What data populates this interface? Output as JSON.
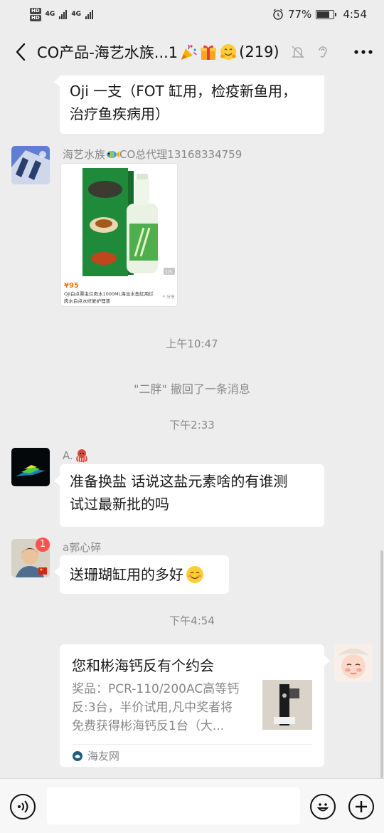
{
  "status_bar": {
    "left_hd_top": "HD",
    "left_hd_bottom": "HD",
    "net1": "4G",
    "net2": "4G",
    "battery": "77%",
    "time": "4:54"
  },
  "header": {
    "title": "CO产品-海艺水族...1",
    "count": "(219)"
  },
  "messages": {
    "top_bubble_line1": "Oji 一支（FOT 缸用，检疫新鱼用，",
    "top_bubble_line2": "治疗鱼疾病用）",
    "shop_sender": "海艺水族",
    "shop_sender_suffix": "CO总代理13168334759",
    "product_price": "¥95",
    "product_desc_line1": "OJI白点票虫烂肉水1000ML海淡水鱼缸用烂",
    "product_desc_line2": "肉水白点水修复护理液",
    "product_share": "分享",
    "product_pager": "1/5",
    "time1": "上午10:47",
    "recall_notice": "\"二胖\" 撤回了一条消息",
    "time2": "下午2:33",
    "sender_a": "A.",
    "msg_a_line1": "准备换盐 话说这盐元素啥的有谁测",
    "msg_a_line2": "试过最新批的吗",
    "sender_guo": "a郭心碎",
    "guo_badge": "1",
    "msg_guo": "送珊瑚缸用的多好",
    "time3": "下午4:54",
    "link_title": "您和彬海钙反有个约会",
    "link_desc_line1": "奖品：PCR-110/200AC高等钙",
    "link_desc_line2": "反:3台，半价试用,凡中奖者将",
    "link_desc_line3": "免费获得彬海钙反1台（大...",
    "link_source": "海友网"
  },
  "icons": {
    "back": "back-arrow-icon",
    "mute": "bell-off-icon",
    "ear": "ear-icon",
    "more": "more-dots-icon",
    "voice": "voice-icon",
    "emoji": "emoji-icon",
    "plus": "plus-icon"
  },
  "colors": {
    "background": "#ededed",
    "bubble": "#ffffff",
    "badge": "#fa5151",
    "meta_text": "#888888"
  }
}
